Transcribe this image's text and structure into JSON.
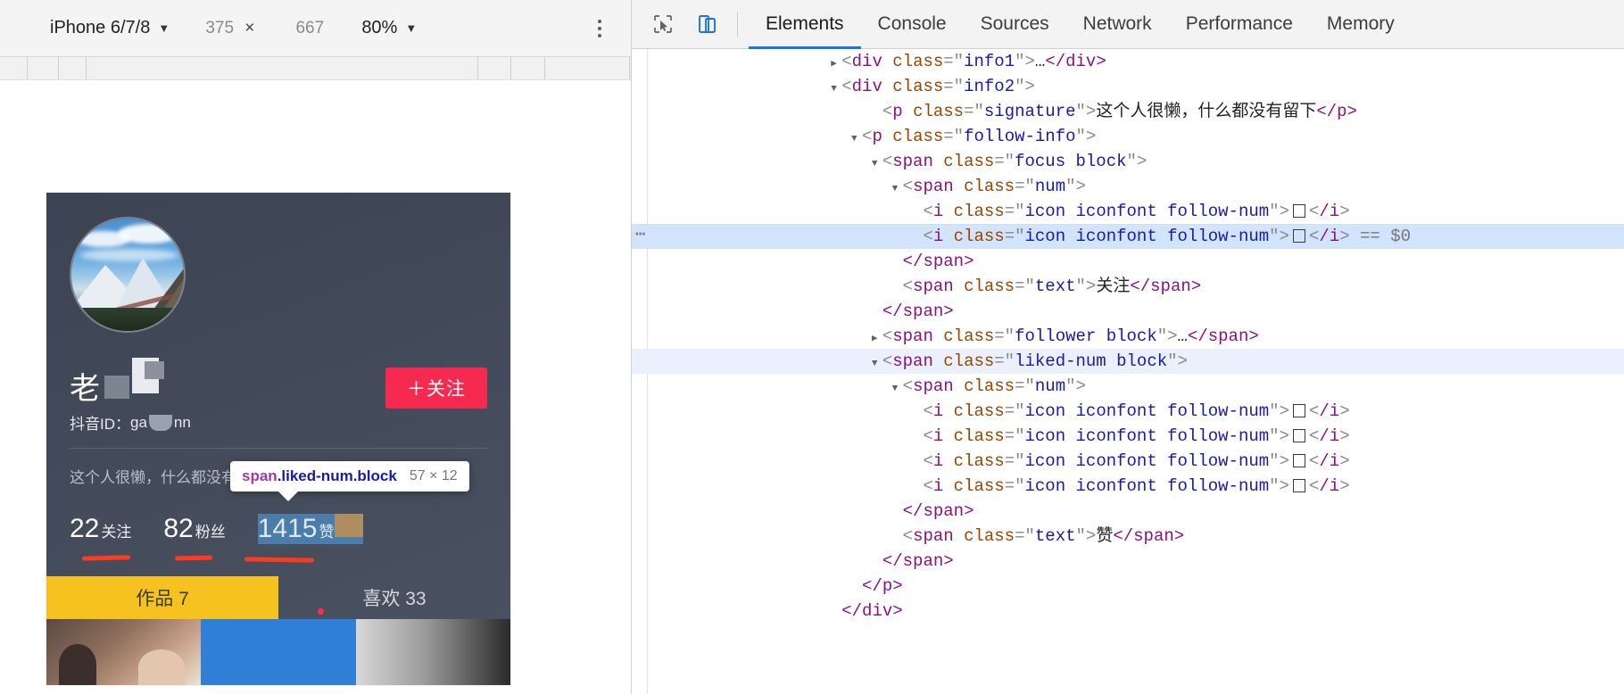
{
  "device_toolbar": {
    "device_name": "iPhone 6/7/8",
    "device_caret": "▼",
    "width": "375",
    "height": "667",
    "times": "×",
    "zoom": "80%",
    "zoom_caret": "▼",
    "more_options": "⋮"
  },
  "devtools": {
    "inspect_icon": "cursor-select-icon",
    "device_toggle_icon": "device-toolbar-icon",
    "tabs": [
      {
        "label": "Elements",
        "active": true
      },
      {
        "label": "Console",
        "active": false
      },
      {
        "label": "Sources",
        "active": false
      },
      {
        "label": "Network",
        "active": false
      },
      {
        "label": "Performance",
        "active": false
      },
      {
        "label": "Memory",
        "active": false
      }
    ]
  },
  "inspect_tooltip": {
    "tag": "span",
    "classes": ".liked-num.block",
    "dimensions": "57 × 12"
  },
  "phone": {
    "follow_button": "＋关注",
    "nickname": "老",
    "douyin_id_label": "抖音ID：",
    "douyin_id_value_start": "ga",
    "douyin_id_value_end": "nn",
    "signature": "这个人很懒，什么都没有留下",
    "stats": [
      {
        "num": "22",
        "text": "关注"
      },
      {
        "num": "82",
        "text": "粉丝"
      },
      {
        "num": "1415",
        "text": "赞"
      }
    ],
    "tabs": [
      {
        "label": "作品 7",
        "active": true
      },
      {
        "label": "喜欢 33",
        "active": false
      }
    ]
  },
  "dom_rows": [
    {
      "indent": 9,
      "twisty": "closed",
      "tag": "div",
      "attr": "class",
      "val": "info1",
      "after_gt": "…</div>",
      "kind": "open-collapsed"
    },
    {
      "indent": 9,
      "twisty": "open",
      "tag": "div",
      "attr": "class",
      "val": "info2",
      "after_gt": "",
      "kind": "open"
    },
    {
      "indent": 11,
      "twisty": "none",
      "tag": "p",
      "attr": "class",
      "val": "signature",
      "after_gt": "这个人很懒，什么都没有留下</p>",
      "kind": "text"
    },
    {
      "indent": 10,
      "twisty": "open",
      "tag": "p",
      "attr": "class",
      "val": "follow-info",
      "after_gt": "",
      "kind": "open"
    },
    {
      "indent": 11,
      "twisty": "open",
      "tag": "span",
      "attr": "class",
      "val": "focus block",
      "after_gt": "",
      "kind": "open"
    },
    {
      "indent": 12,
      "twisty": "open",
      "tag": "span",
      "attr": "class",
      "val": "num",
      "after_gt": "",
      "kind": "open"
    },
    {
      "indent": 13,
      "twisty": "none",
      "tag": "i",
      "attr": "class",
      "val": "icon iconfont follow-num",
      "after_gt": "",
      "kind": "icon"
    },
    {
      "indent": 13,
      "twisty": "none",
      "tag": "i",
      "attr": "class",
      "val": "icon iconfont follow-num",
      "after_gt": "",
      "kind": "icon-selected",
      "selected": true,
      "dollar": "== $0",
      "dots": "…"
    },
    {
      "indent": 12,
      "twisty": "none",
      "tag": "",
      "close": "</span>",
      "kind": "close"
    },
    {
      "indent": 12,
      "twisty": "none",
      "tag": "span",
      "attr": "class",
      "val": "text",
      "after_gt": "关注</span>",
      "kind": "text"
    },
    {
      "indent": 11,
      "twisty": "none",
      "tag": "",
      "close": "</span>",
      "kind": "close"
    },
    {
      "indent": 11,
      "twisty": "closed",
      "tag": "span",
      "attr": "class",
      "val": "follower block",
      "after_gt": "…</span>",
      "kind": "open-collapsed"
    },
    {
      "indent": 11,
      "twisty": "open",
      "tag": "span",
      "attr": "class",
      "val": "liked-num block",
      "after_gt": "",
      "kind": "open",
      "soft": true
    },
    {
      "indent": 12,
      "twisty": "open",
      "tag": "span",
      "attr": "class",
      "val": "num",
      "after_gt": "",
      "kind": "open"
    },
    {
      "indent": 13,
      "twisty": "none",
      "tag": "i",
      "attr": "class",
      "val": "icon iconfont follow-num",
      "after_gt": "",
      "kind": "icon"
    },
    {
      "indent": 13,
      "twisty": "none",
      "tag": "i",
      "attr": "class",
      "val": "icon iconfont follow-num",
      "after_gt": "",
      "kind": "icon"
    },
    {
      "indent": 13,
      "twisty": "none",
      "tag": "i",
      "attr": "class",
      "val": "icon iconfont follow-num",
      "after_gt": "",
      "kind": "icon"
    },
    {
      "indent": 13,
      "twisty": "none",
      "tag": "i",
      "attr": "class",
      "val": "icon iconfont follow-num",
      "after_gt": "",
      "kind": "icon"
    },
    {
      "indent": 12,
      "twisty": "none",
      "tag": "",
      "close": "</span>",
      "kind": "close"
    },
    {
      "indent": 12,
      "twisty": "none",
      "tag": "span",
      "attr": "class",
      "val": "text",
      "after_gt": "赞</span>",
      "kind": "text"
    },
    {
      "indent": 11,
      "twisty": "none",
      "tag": "",
      "close": "</span>",
      "kind": "close"
    },
    {
      "indent": 10,
      "twisty": "none",
      "tag": "",
      "close": "</p>",
      "kind": "close"
    },
    {
      "indent": 9,
      "twisty": "none",
      "tag": "",
      "close": "</div>",
      "kind": "close"
    }
  ],
  "colors": {
    "accent_follow": "#f62a51",
    "tab_active": "#f5c220",
    "devtools_tab_underline": "#1a73e8",
    "annotation": "#ff3b17",
    "selection": "#d2e3fc"
  }
}
